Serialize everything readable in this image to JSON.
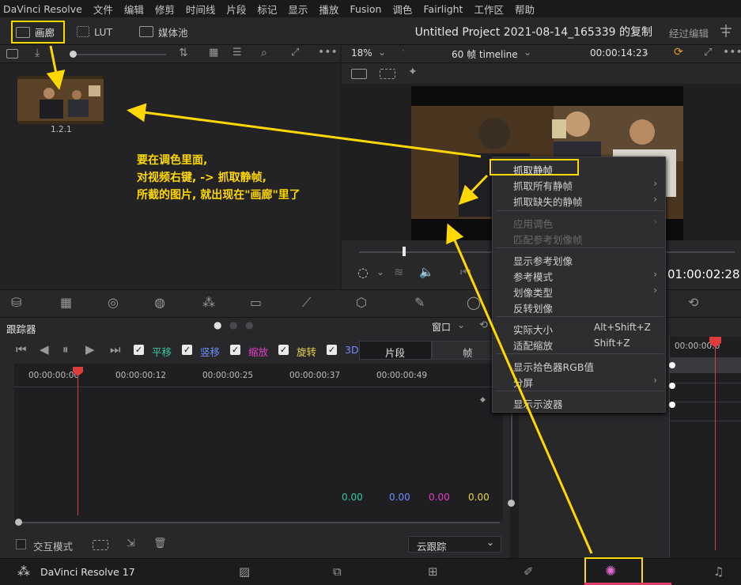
{
  "menu": [
    "DaVinci Resolve",
    "文件",
    "编辑",
    "修剪",
    "时间线",
    "片段",
    "标记",
    "显示",
    "播放",
    "Fusion",
    "调色",
    "Fairlight",
    "工作区",
    "帮助"
  ],
  "topbar": {
    "gallery_label": "画廊",
    "lut_label": "LUT",
    "media_pool_label": "媒体池",
    "project_title": "Untitled Project 2021-08-14_165339 的复制",
    "mode_label": "经过编辑"
  },
  "viewer": {
    "zoom": "18%",
    "timeline_name": "60 帧 timeline",
    "timecode": "00:00:14:23",
    "playhead_tc": "01:00:02:28"
  },
  "gallery": {
    "still_label": "1.2.1"
  },
  "annotation": {
    "line1": "要在调色里面,",
    "line2": "对视频右键, -> 抓取静帧,",
    "line3": "所截的图片, 就出现在\"画廊\"里了"
  },
  "context_menu": {
    "grab_still": "抓取静帧",
    "grab_all_stills": "抓取所有静帧",
    "grab_missing_stills": "抓取缺失的静帧",
    "apply_grade": "应用调色",
    "match_reference": "匹配参考划像帧",
    "show_reference": "显示参考划像",
    "reference_mode": "参考模式",
    "wipe_type": "划像类型",
    "invert_wipe": "反转划像",
    "actual_size": "实际大小",
    "actual_size_sc": "Alt+Shift+Z",
    "fit_zoom": "适配缩放",
    "fit_zoom_sc": "Shift+Z",
    "show_picker_rgb": "显示拾色器RGB值",
    "split_screen": "分屏",
    "show_scope": "显示示波器"
  },
  "tracker": {
    "title": "跟踪器",
    "window_label": "窗口",
    "pan": "平移",
    "tilt": "竖移",
    "zoom": "缩放",
    "rotate": "旋转",
    "threed": "3D",
    "clip_tab": "片段",
    "frame_tab": "帧",
    "ruler": [
      "00:00:00:00",
      "00:00:00:12",
      "00:00:00:25",
      "00:00:00:37",
      "00:00:00:49"
    ],
    "values": [
      "0.00",
      "0.00",
      "0.00",
      "0.00"
    ],
    "value_colors": [
      "#38c9a0",
      "#6f8cff",
      "#e040c8",
      "#e8d640"
    ],
    "interactive_mode": "交互模式",
    "cloud_tracker": "云跟踪",
    "right_tc": "00:00:00:0"
  },
  "bottom": {
    "app_name": "DaVinci Resolve 17"
  },
  "colors": {
    "annotation": "#ffd800",
    "playhead": "#e03c3c",
    "panel": "#28282b"
  }
}
